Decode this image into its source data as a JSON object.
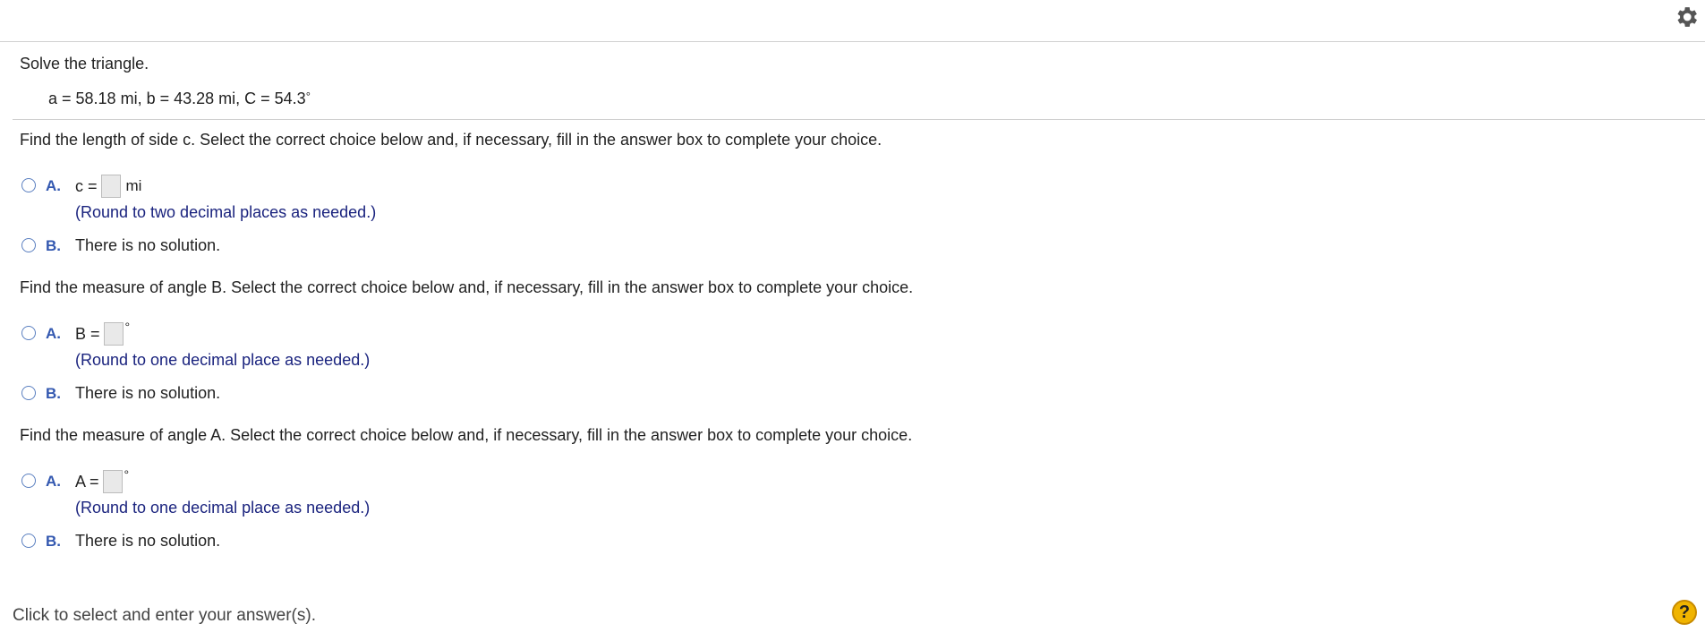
{
  "header": {
    "settings_icon": "gear-icon"
  },
  "problem": {
    "title": "Solve the triangle.",
    "given": "a = 58.18 mi, b = 43.28 mi, C = 54.3",
    "given_degree": "°"
  },
  "parts": [
    {
      "question": "Find the length of side c. Select the correct choice below and, if necessary, fill in the answer box to complete your choice.",
      "choice_a": {
        "letter": "A.",
        "prefix": "c =",
        "unit": "mi",
        "hint": "(Round to two decimal places as needed.)"
      },
      "choice_b": {
        "letter": "B.",
        "text": "There is no solution."
      }
    },
    {
      "question": "Find the measure of angle B. Select the correct choice below and, if necessary, fill in the answer box to complete your choice.",
      "choice_a": {
        "letter": "A.",
        "prefix": "B =",
        "unit": "°",
        "hint": "(Round to one decimal place as needed.)"
      },
      "choice_b": {
        "letter": "B.",
        "text": "There is no solution."
      }
    },
    {
      "question": "Find the measure of angle A. Select the correct choice below and, if necessary, fill in the answer box to complete your choice.",
      "choice_a": {
        "letter": "A.",
        "prefix": "A =",
        "unit": "°",
        "hint": "(Round to one decimal place as needed.)"
      },
      "choice_b": {
        "letter": "B.",
        "text": "There is no solution."
      }
    }
  ],
  "footer": {
    "instruction": "Click to select and enter your answer(s).",
    "help_label": "?"
  }
}
